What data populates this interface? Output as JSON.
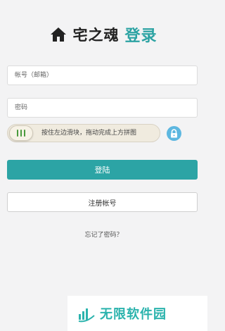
{
  "header": {
    "home_icon": "home-icon",
    "brand": "宅之魂",
    "title": "登录",
    "accent_color": "#2ca3a3"
  },
  "form": {
    "account_placeholder": "帐号（邮箱）",
    "password_placeholder": "密码",
    "slider_hint": "按住左边滑块，拖动完成上方拼图",
    "slider_progress": 0,
    "lock_icon": "lock-icon",
    "login_label": "登陆",
    "register_label": "注册帐号",
    "forgot_label": "忘记了密码？",
    "button_color": "#2ca4a5",
    "lock_color": "#5db7e0"
  },
  "watermark": {
    "text": "无限软件园",
    "color": "#2bb3ad"
  }
}
